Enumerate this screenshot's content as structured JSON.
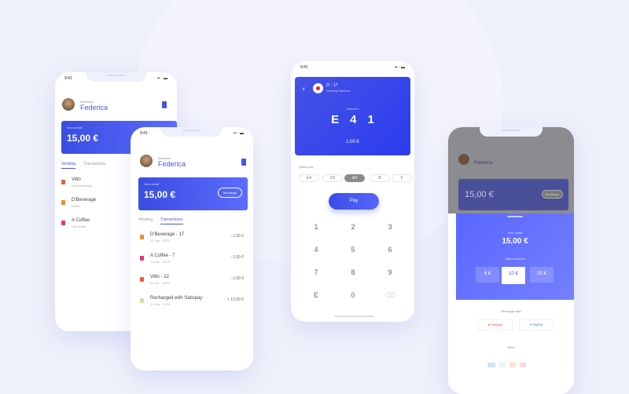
{
  "time": "9:41",
  "user": {
    "greeting": "Welcome",
    "name": "Federica"
  },
  "balance": {
    "label": "Your credit",
    "amount": "15,00 €",
    "recharge": "Recharge"
  },
  "tabs": [
    "Vending",
    "Transactions"
  ],
  "vending": [
    {
      "title": "Vitto",
      "sub": "Vitto Beverage",
      "color": "#f25a3a"
    },
    {
      "title": "D'Beverage",
      "sub": "Drinks",
      "color": "#f28a2a"
    },
    {
      "title": "A Coffee",
      "sub": "Hot Drinks",
      "color": "#f0306a"
    }
  ],
  "transactions": [
    {
      "title": "D'Beverage - 17",
      "sub": "12 Jan · 10:20",
      "value": "- 1,00 €",
      "color": "#f28a2a"
    },
    {
      "title": "A Coffee - 7",
      "sub": "12 Jan · 09:15",
      "value": "- 1,00 €",
      "color": "#f0306a"
    },
    {
      "title": "Vitto - 32",
      "sub": "11 Jan · 18:02",
      "value": "- 1,00 €",
      "color": "#f25a3a"
    },
    {
      "title": "Recharged with Satispay",
      "sub": "10 Jan · 12:00",
      "value": "+ 10,00 €",
      "color": "#cfe0a8"
    }
  ],
  "pay": {
    "machine": "D' - 17",
    "machine_sub": "Vending Machine",
    "selection_label": "Selection",
    "code": [
      "E",
      "4",
      "1"
    ],
    "price": "1,00 €",
    "quick_label": "Quick pick",
    "chips": [
      "E4",
      "C6",
      "A4",
      "B",
      "F"
    ],
    "pay_button": "Pay",
    "keys": [
      "1",
      "2",
      "3",
      "4",
      "5",
      "6",
      "7",
      "8",
      "9",
      "E",
      "0",
      "⌫"
    ]
  },
  "recharge_sheet": {
    "label": "Your credit",
    "amount": "15,00 €",
    "select": "Select amount",
    "options": [
      "5 €",
      "10 €",
      "20 €"
    ],
    "selected": 1,
    "method_label": "Recharge with",
    "methods": [
      "Satispay",
      "PayPal"
    ],
    "other": "Other"
  },
  "colors": {
    "accent": "#4a55e0",
    "background": "#eef0fb"
  }
}
